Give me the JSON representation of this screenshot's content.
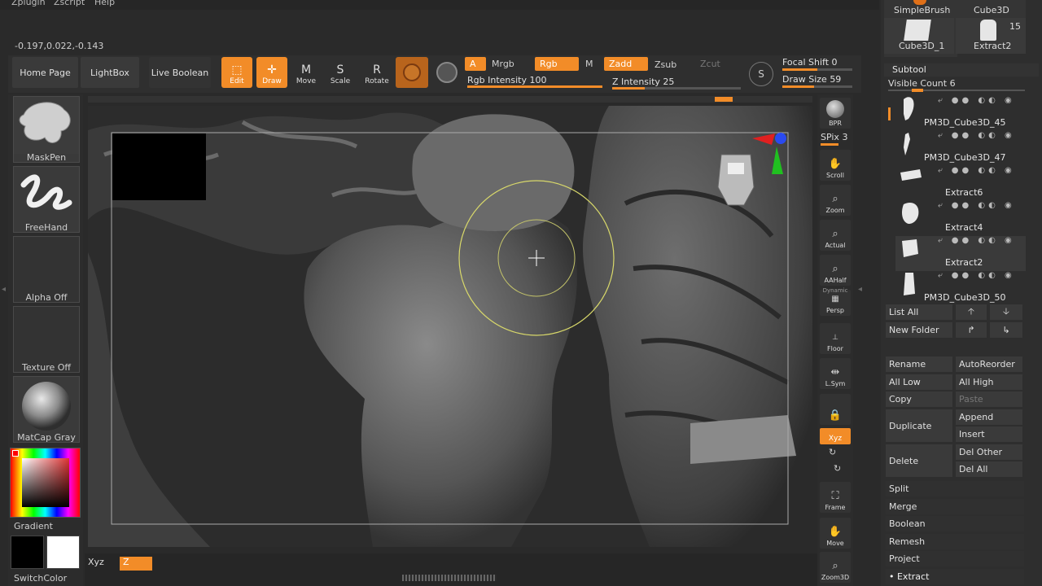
{
  "menu": [
    "Zplugin",
    "Zscript",
    "Help"
  ],
  "coords": "-0.197,0.022,-0.143",
  "nav_buttons": [
    "Home Page",
    "LightBox",
    "Live Boolean"
  ],
  "tools": {
    "edit": "Edit",
    "draw": "Draw",
    "move": "Move",
    "scale": "Scale",
    "rotate": "Rotate",
    "move_key": "M",
    "scale_key": "S",
    "rotate_key": "R"
  },
  "color_modes": {
    "a": "A",
    "mrgb": "Mrgb",
    "rgb": "Rgb",
    "m": "M",
    "zadd": "Zadd",
    "zsub": "Zsub",
    "zcut": "Zcut"
  },
  "sliders": {
    "rgb_intensity_label": "Rgb Intensity",
    "rgb_intensity": "100",
    "rgb_intensity_frac": 1.0,
    "z_intensity_label": "Z Intensity",
    "z_intensity": "25",
    "z_intensity_frac": 0.25,
    "focal_shift_label": "Focal Shift",
    "focal_shift": "0",
    "focal_shift_frac": 0.5,
    "draw_size_label": "Draw Size",
    "draw_size": "59",
    "draw_size_frac": 0.45
  },
  "left_tray": {
    "brush": "MaskPen",
    "stroke": "FreeHand",
    "alpha": "Alpha Off",
    "texture": "Texture Off",
    "material": "MatCap Gray",
    "gradient": "Gradient",
    "switch_color": "SwitchColor"
  },
  "right_tools": {
    "bpr": "BPR",
    "spix_label": "SPix",
    "spix_value": "3",
    "scroll": "Scroll",
    "zoom": "Zoom",
    "actual": "Actual",
    "aahalf": "AAHalf",
    "dynamic": "Dynamic",
    "persp": "Persp",
    "floor": "Floor",
    "lsym": "L.Sym",
    "xyz": "Xyz",
    "frame": "Frame",
    "move": "Move",
    "zoom3d": "Zoom3D"
  },
  "top_tools": {
    "simple_brush": "SimpleBrush",
    "cube3d": "Cube3D",
    "cube3d_1": "Cube3D_1",
    "extract2": "Extract2",
    "count": "15"
  },
  "subtool": {
    "title": "Subtool",
    "visible_count_label": "Visible Count",
    "visible_count": "6",
    "items": [
      "PM3D_Cube3D_45",
      "PM3D_Cube3D_47",
      "Extract6",
      "Extract4",
      "Extract2",
      "PM3D_Cube3D_50"
    ],
    "list_all": "List All",
    "new_folder": "New Folder",
    "rename": "Rename",
    "auto_reorder": "AutoReorder",
    "all_low": "All Low",
    "all_high": "All High",
    "copy": "Copy",
    "paste": "Paste",
    "duplicate": "Duplicate",
    "append": "Append",
    "insert": "Insert",
    "delete": "Delete",
    "del_other": "Del Other",
    "del_all": "Del All",
    "sections": [
      "Split",
      "Merge",
      "Boolean",
      "Remesh",
      "Project",
      "Extract"
    ]
  },
  "bottom": {
    "xyz_label": "Xyz",
    "z_button": "Z"
  },
  "colors": {
    "accent": "#f28c28",
    "background": "#2a2a2a"
  }
}
